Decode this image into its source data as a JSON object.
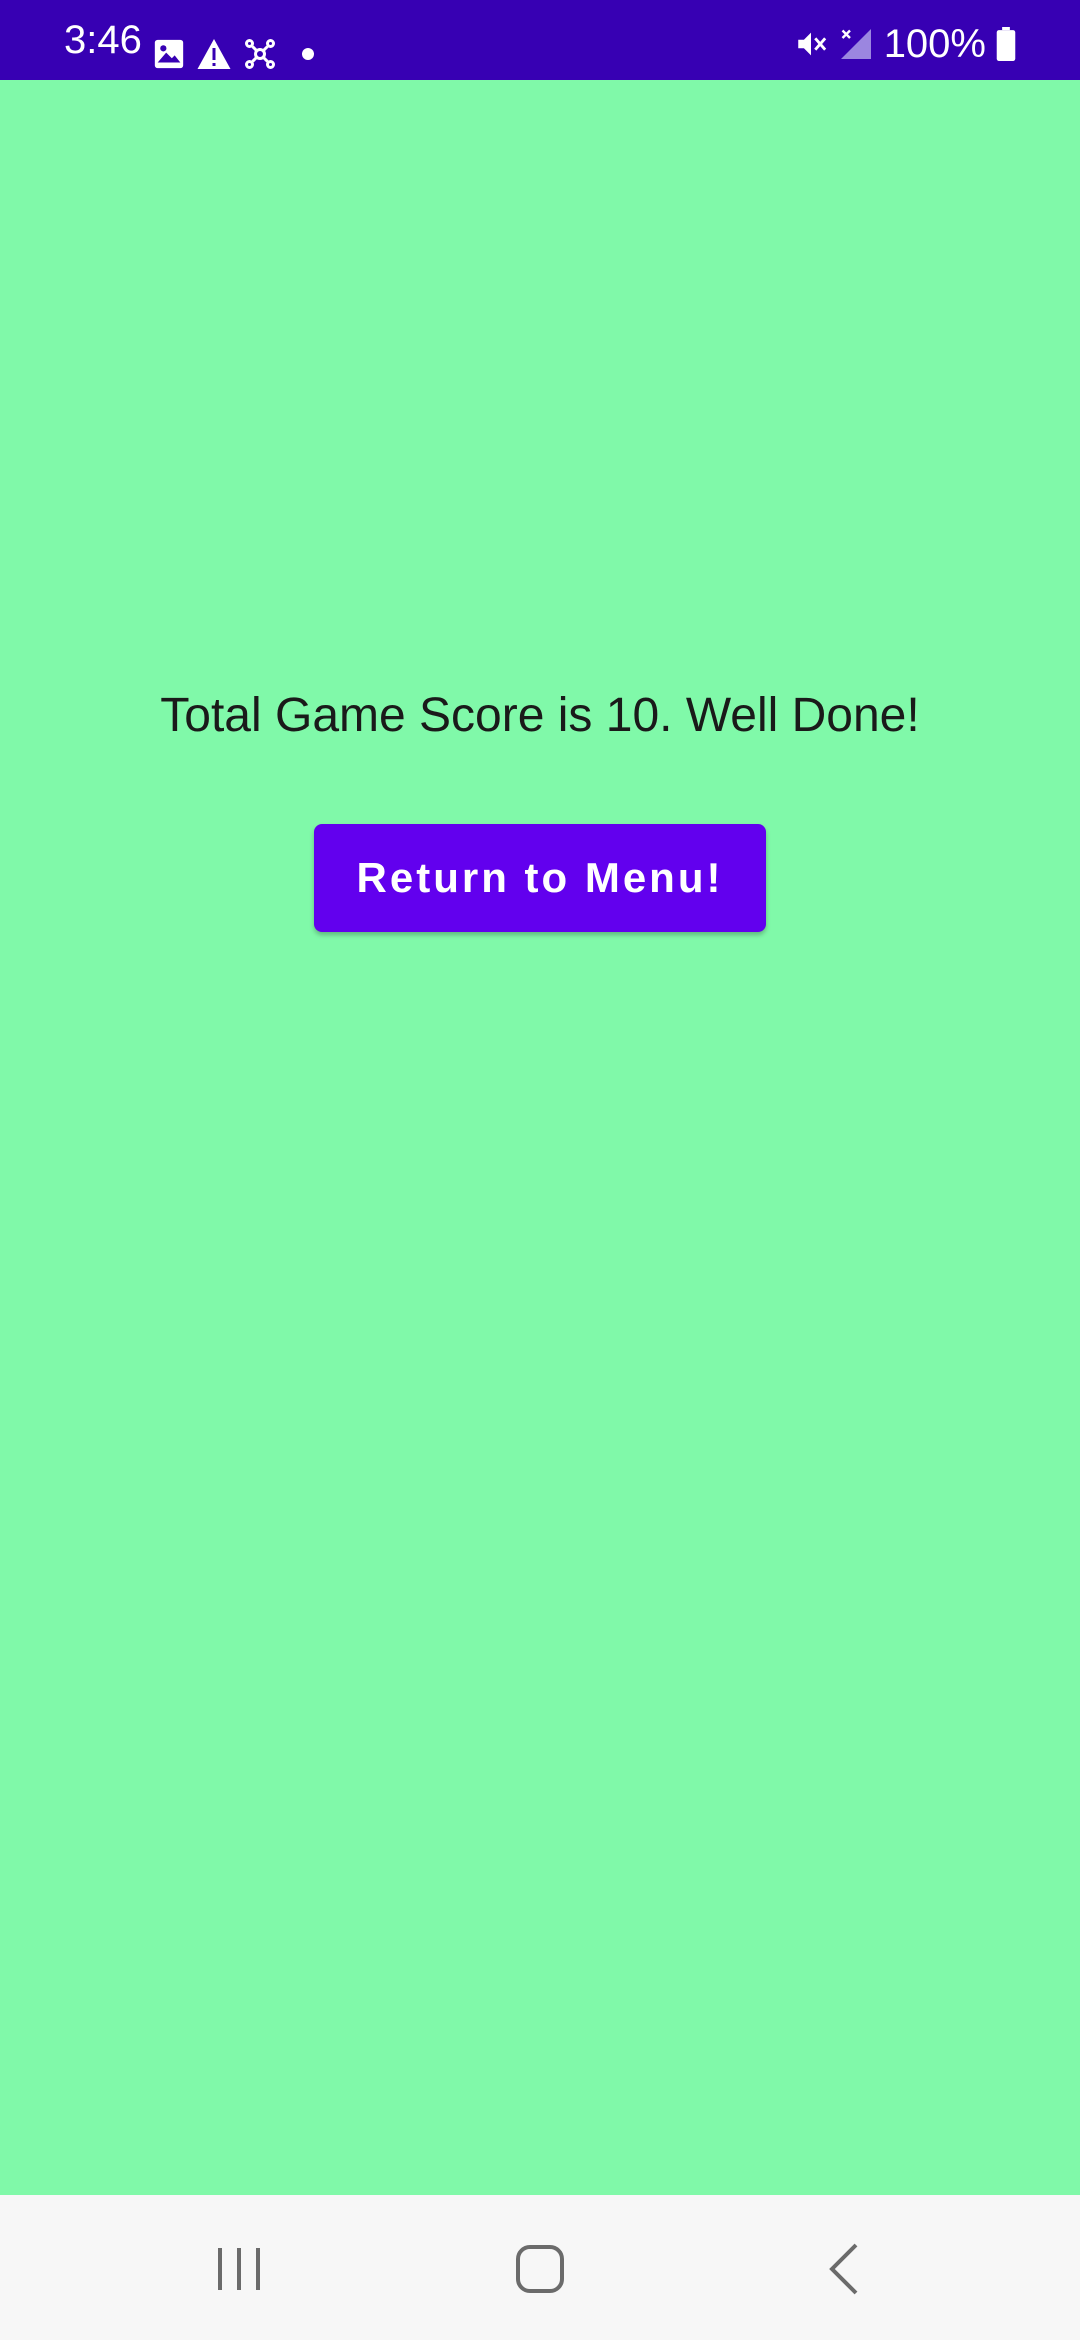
{
  "status_bar": {
    "time": "3:46",
    "battery": "100%",
    "background_color": "#3700B3",
    "icons_left": [
      "image-icon",
      "warning-icon",
      "network-icon",
      "dot-icon"
    ],
    "icons_right": [
      "mute-icon",
      "signal-icon",
      "battery-icon"
    ]
  },
  "main": {
    "background_color": "#80F9A9",
    "score_message": "Total Game Score is 10. Well Done!",
    "return_button_label": "Return to Menu!",
    "button_color": "#6200EE"
  },
  "nav_bar": {
    "buttons": [
      "recents-icon",
      "home-icon",
      "back-icon"
    ]
  }
}
